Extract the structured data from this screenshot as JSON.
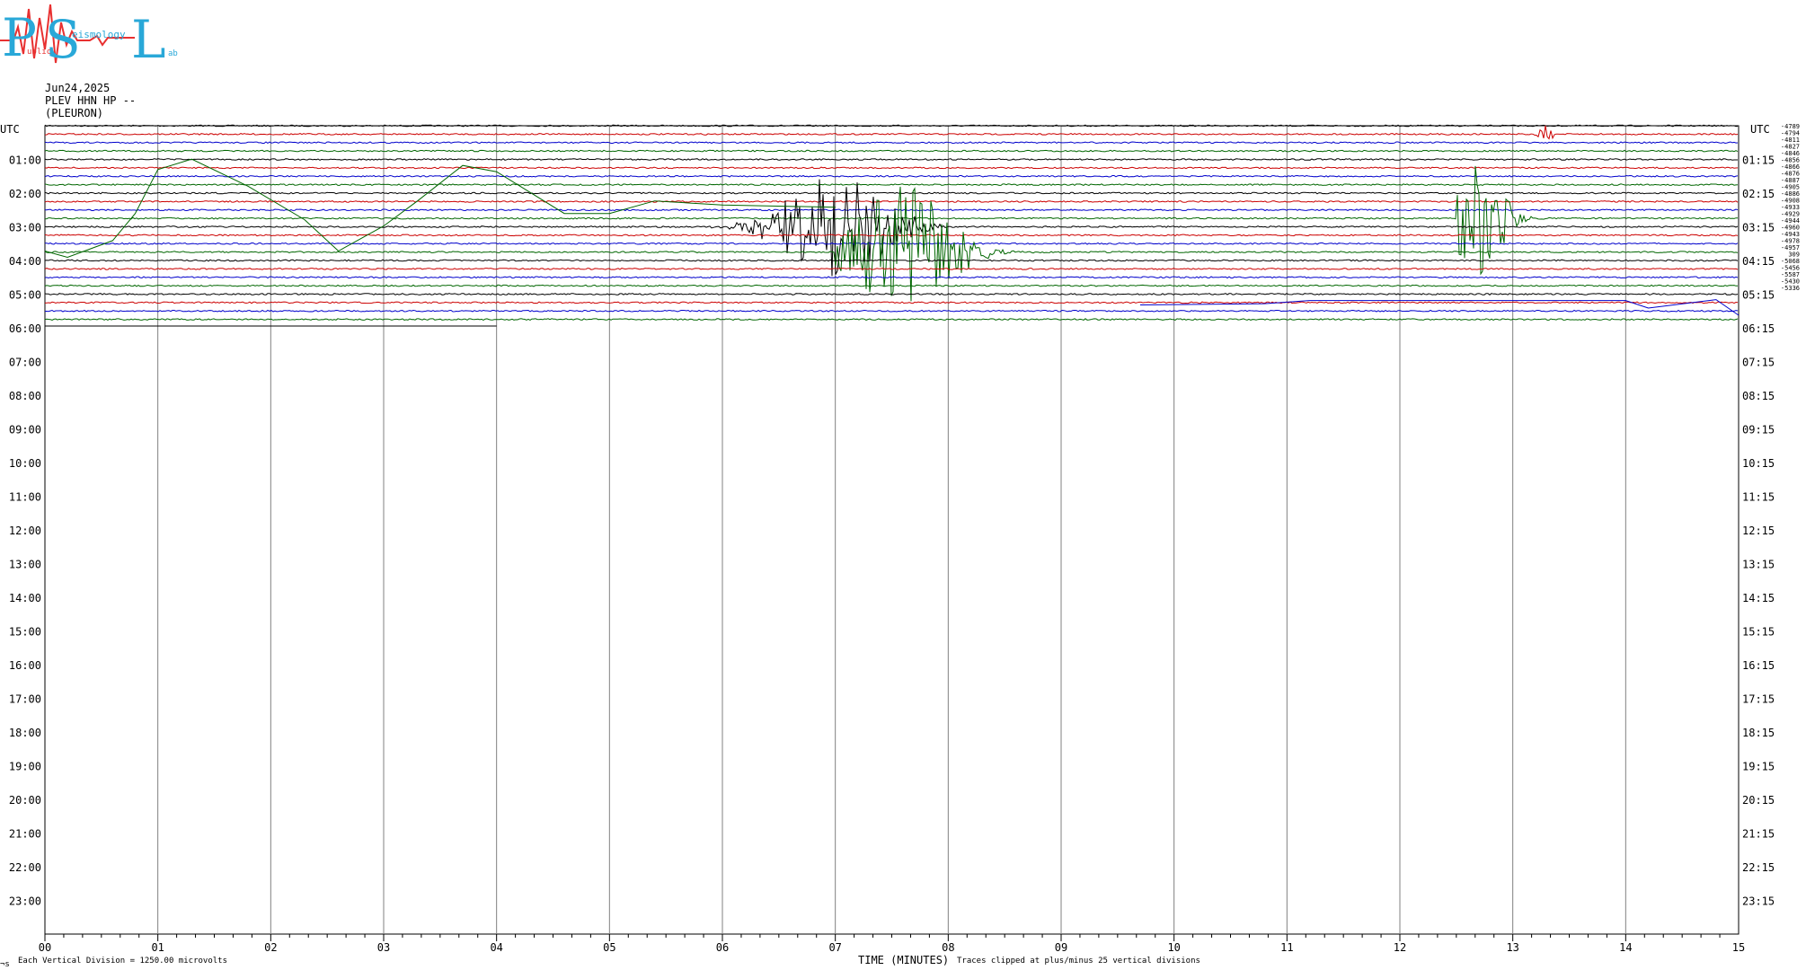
{
  "logo": {
    "letters": "PSL",
    "words": [
      "ublic",
      "eismology",
      "ab"
    ]
  },
  "header": {
    "date": "Jun24,2025",
    "station": "PLEV HHN HP --",
    "location": "(PLEURON)"
  },
  "corner": {
    "left": "UTC",
    "right": "UTC"
  },
  "footer": {
    "mark": "¬s",
    "vertical_division": "Each Vertical Division = 1250.00 microvolts",
    "xlabel": "TIME (MINUTES)",
    "clip_note": "Traces clipped at plus/minus 25 vertical divisions"
  },
  "colors": {
    "black": "#000000",
    "red": "#cc0000",
    "blue": "#0000cc",
    "green": "#006600",
    "grid": "#808080",
    "logo_blue": "#29a8d8",
    "logo_red": "#e83030"
  },
  "chart_data": {
    "type": "line",
    "title": "",
    "xlabel": "TIME (MINUTES)",
    "x_ticks": [
      "00",
      "01",
      "02",
      "03",
      "04",
      "05",
      "06",
      "07",
      "08",
      "09",
      "10",
      "11",
      "12",
      "13",
      "14",
      "15"
    ],
    "xlim": [
      0,
      15
    ],
    "left_labels": [
      "01:00",
      "02:00",
      "03:00",
      "04:00",
      "05:00",
      "06:00",
      "07:00",
      "08:00",
      "09:00",
      "10:00",
      "11:00",
      "12:00",
      "13:00",
      "14:00",
      "15:00",
      "16:00",
      "17:00",
      "18:00",
      "19:00",
      "20:00",
      "21:00",
      "22:00",
      "23:00"
    ],
    "right_labels": [
      "01:15",
      "02:15",
      "03:15",
      "04:15",
      "05:15",
      "06:15",
      "07:15",
      "08:15",
      "09:15",
      "10:15",
      "11:15",
      "12:15",
      "13:15",
      "14:15",
      "15:15",
      "16:15",
      "17:15",
      "18:15",
      "19:15",
      "20:15",
      "21:15",
      "22:15",
      "23:15"
    ],
    "trace_offsets": [
      "-4789",
      "-4794",
      "-4811",
      "-4827",
      "-4846",
      "-4856",
      "-4866",
      "-4876",
      "-4887",
      "-4905",
      "-4886",
      "-4908",
      "-4933",
      "-4929",
      "-4944",
      "-4960",
      "-4943",
      "-4978",
      "-4957",
      "309",
      "-5068",
      "-5456",
      "-5587",
      "-5430",
      "-5336"
    ],
    "trace_colors": [
      "black",
      "red",
      "blue",
      "green",
      "black",
      "red",
      "blue",
      "green",
      "black",
      "red",
      "blue",
      "green",
      "black",
      "red",
      "blue",
      "green",
      "black",
      "red",
      "blue",
      "green",
      "black",
      "red",
      "blue",
      "green",
      "black"
    ],
    "traces_recorded": 24,
    "events": [
      {
        "trace": 12,
        "start_min": 5.8,
        "end_min": 8.0,
        "peak_min": 7.0,
        "amplitude_divs": 6
      },
      {
        "trace": 15,
        "start_min": 7.0,
        "end_min": 9.0,
        "peak_min": 7.6,
        "amplitude_divs": 8
      },
      {
        "trace": 11,
        "start_min": 12.5,
        "end_min": 13.5,
        "peak_min": 12.7,
        "amplitude_divs": 7
      },
      {
        "trace": 1,
        "start_min": 13.1,
        "end_min": 13.4,
        "peak_min": 13.3,
        "amplitude_divs": 1
      }
    ]
  }
}
